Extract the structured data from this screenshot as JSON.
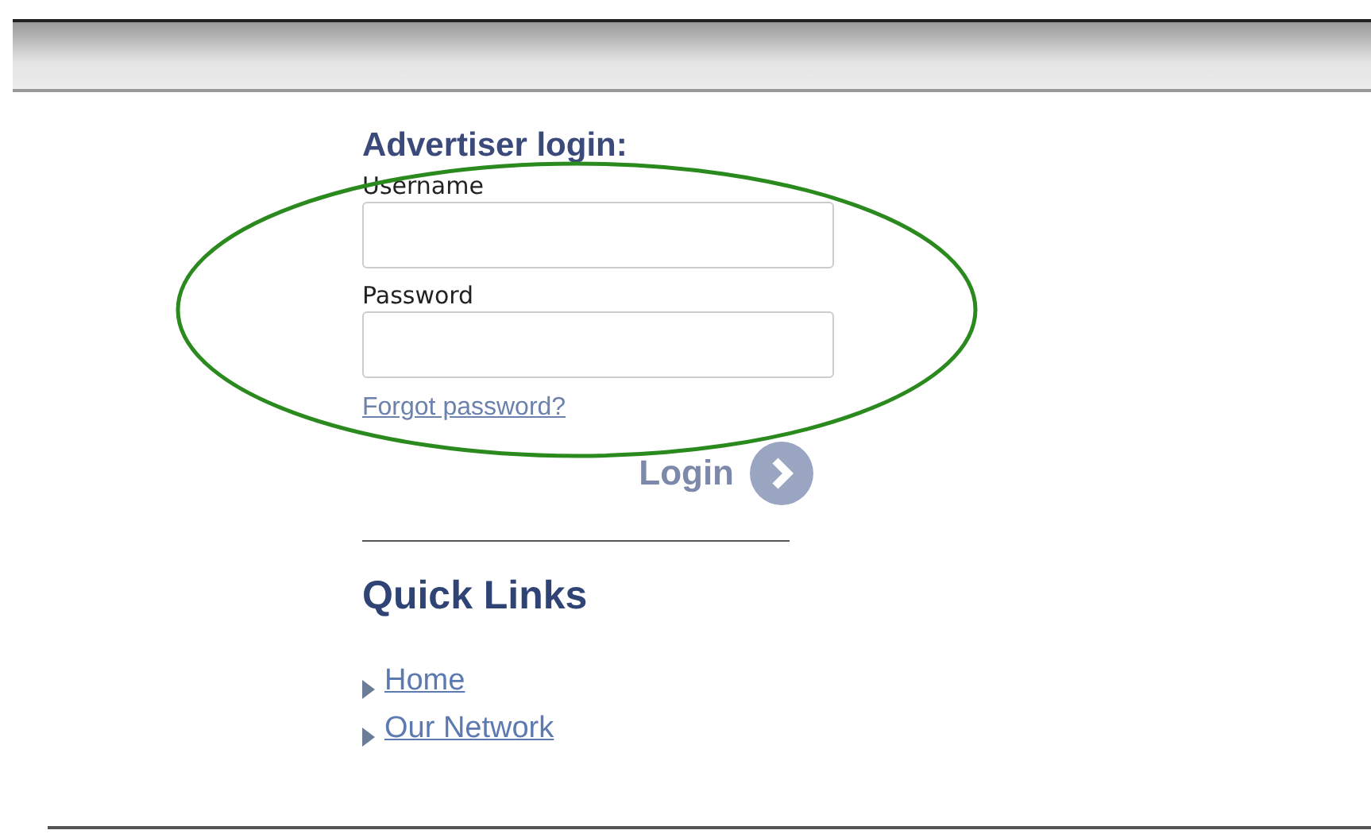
{
  "login": {
    "title": "Advertiser login:",
    "fields": [
      {
        "label": "Username"
      },
      {
        "label": "Password"
      }
    ],
    "forgot_link": "Forgot password?",
    "submit": "Login"
  },
  "quick_links": {
    "title": "Quick Links",
    "links": [
      "Home",
      "Our Network"
    ]
  }
}
